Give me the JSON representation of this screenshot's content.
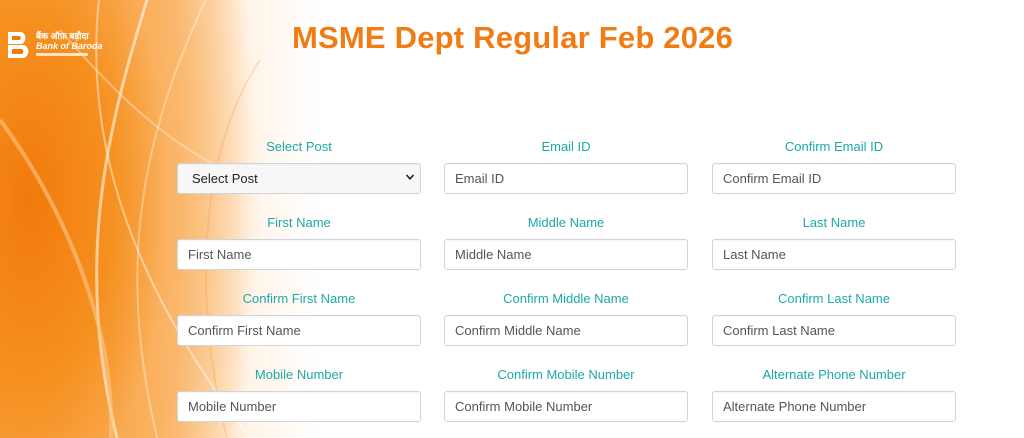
{
  "brand": {
    "hindi": "बैंक ऑफ़ बड़ौदा",
    "name": "Bank of Baroda",
    "colors": {
      "primary": "#f07c13",
      "label": "#1ea8a8",
      "border": "#cfd4da"
    }
  },
  "page": {
    "title": "MSME Dept Regular Feb 2026"
  },
  "form": {
    "select_post": {
      "label": "Select Post",
      "selected": "Select Post",
      "icon": "chevron-down-icon"
    },
    "email": {
      "label": "Email ID",
      "placeholder": "Email ID"
    },
    "confirm_email": {
      "label": "Confirm Email ID",
      "placeholder": "Confirm Email ID"
    },
    "first_name": {
      "label": "First Name",
      "placeholder": "First Name"
    },
    "middle_name": {
      "label": "Middle Name",
      "placeholder": "Middle Name"
    },
    "last_name": {
      "label": "Last Name",
      "placeholder": "Last Name"
    },
    "confirm_first_name": {
      "label": "Confirm First Name",
      "placeholder": "Confirm First Name"
    },
    "confirm_middle_name": {
      "label": "Confirm Middle Name",
      "placeholder": "Confirm Middle Name"
    },
    "confirm_last_name": {
      "label": "Confirm Last Name",
      "placeholder": "Confirm Last Name"
    },
    "mobile": {
      "label": "Mobile Number",
      "placeholder": "Mobile Number"
    },
    "confirm_mobile": {
      "label": "Confirm Mobile Number",
      "placeholder": "Confirm Mobile Number"
    },
    "alt_phone": {
      "label": "Alternate Phone Number",
      "placeholder": "Alternate Phone Number"
    }
  }
}
